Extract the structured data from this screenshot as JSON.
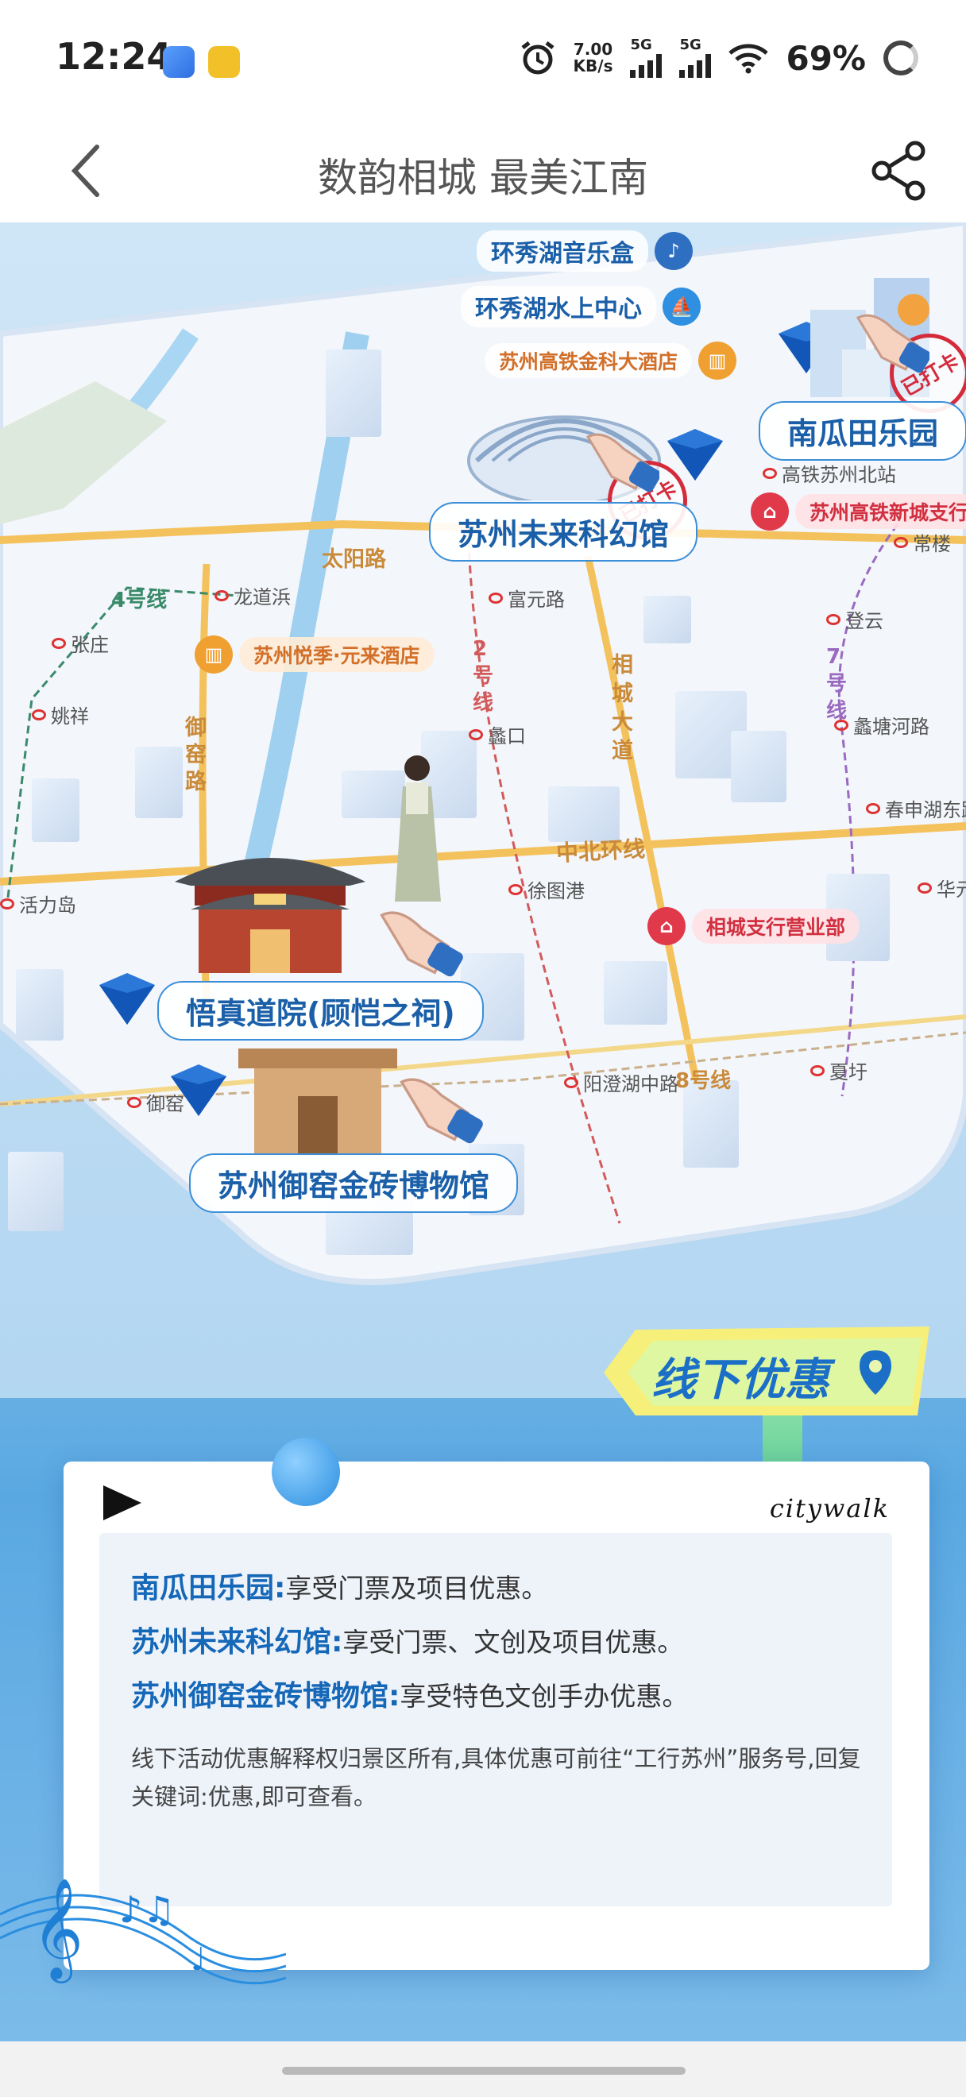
{
  "status_bar": {
    "time": "12:24",
    "speed_value": "7.00",
    "speed_unit": "KB/s",
    "network_1": "5G",
    "network_2": "5G",
    "battery": "69%",
    "icons": [
      "message-app-icon",
      "copy-app-icon",
      "alarm-icon",
      "signal-icon",
      "wifi-icon",
      "battery-ring-icon"
    ]
  },
  "header": {
    "title": "数韵相城 最美江南",
    "back_icon": "back-chevron-icon",
    "share_icon": "share-icon"
  },
  "map": {
    "attractions": [
      {
        "name": "苏州未来科幻馆"
      },
      {
        "name": "南瓜田乐园"
      },
      {
        "name": "悟真道院(顾恺之祠)"
      },
      {
        "name": "苏州御窑金砖博物馆"
      }
    ],
    "tags": {
      "music_box": "环秀湖音乐盒",
      "water_center": "环秀湖水上中心",
      "hotel_hsr": "苏州高铁金科大酒店",
      "hotel_yuelai": "苏州悦季·元来酒店",
      "bank_hsr": "苏州高铁新城支行",
      "bank_xiangcheng": "相城支行营业部"
    },
    "stamp_text": "已打卡",
    "roads": {
      "taiyang": "太阳路",
      "yuyao": "御窑路",
      "xiangcheng": "相城大道",
      "zhongbei": "中北环线"
    },
    "metro_lines": {
      "line4": "4号线",
      "line2": "2号线",
      "line7": "7号线",
      "line8": "8号线"
    },
    "stations": {
      "longdaobang": "龙道浜",
      "zhangzhuang": "张庄",
      "yaoxiang": "姚祥",
      "huolidao": "活力岛",
      "fuyuanlu": "富元路",
      "likou": "蠡口",
      "xutugang": "徐图港",
      "yangchenghu": "阳澄湖中路",
      "yuyao_st": "御窑",
      "gaotie": "高铁苏州北站",
      "changlou": "常楼",
      "dengyun": "登云",
      "litanghe": "蠡塘河路",
      "chunshen": "春申湖东路",
      "huayuan": "华元",
      "xiahang": "夏圩"
    }
  },
  "offline": {
    "banner_text": "线下优惠",
    "brand": "citywalk",
    "offers": [
      {
        "place": "南瓜田乐园:",
        "desc": "享受门票及项目优惠。"
      },
      {
        "place": "苏州未来科幻馆:",
        "desc": "享受门票、文创及项目优惠。"
      },
      {
        "place": "苏州御窑金砖博物馆:",
        "desc": "享受特色文创手办优惠。"
      }
    ],
    "note": "线下活动优惠解释权归景区所有,具体优惠可前往“工行苏州”服务号,回复关键词:优惠,即可查看。"
  },
  "colors": {
    "brand_blue": "#1567b8",
    "accent_red": "#e0394a",
    "metro_red": "#d33a3a",
    "road_yellow": "#f4c25c"
  }
}
